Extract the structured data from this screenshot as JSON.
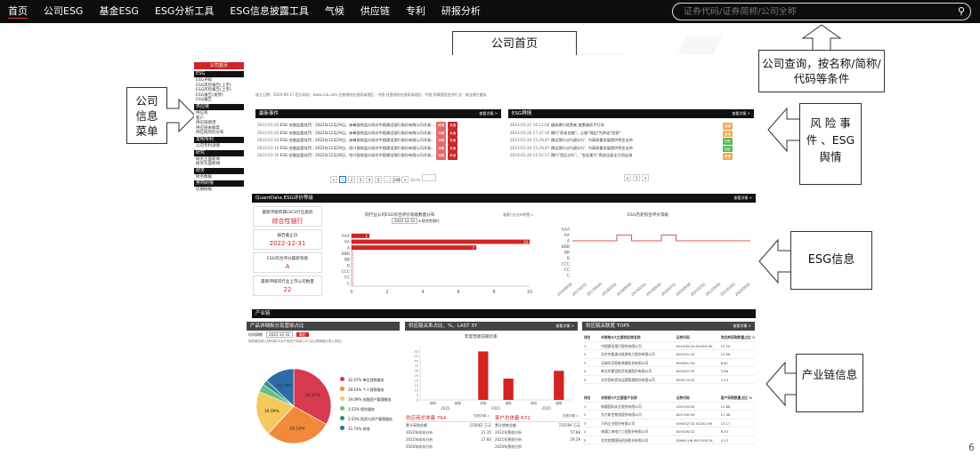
{
  "topnav": {
    "items": [
      "首页",
      "公司ESG",
      "基金ESG",
      "ESG分析工具",
      "ESG信息披露工具",
      "气候",
      "供应链",
      "专利",
      "研报分析"
    ],
    "search_placeholder": "证券代码/证券简称/公司全称",
    "search_icon": "search-icon"
  },
  "callouts": {
    "home": "公司首页",
    "query": "公司查询，按名称/简称/代码等条件",
    "menu": "公司\n信息\n菜单",
    "risk": "风 险 事件 、ESG舆情",
    "esg": "ESG信息",
    "supply": "产业链信息"
  },
  "page_number": "6",
  "dash": {
    "sidebar": {
      "header": "公司首页",
      "groups": [
        {
          "title": "ESG",
          "items": [
            "ESG评级",
            "ESG风险报告(上市)",
            "ESG风险报告(上市)",
            "ESG报告(发债)",
            "ESG报告"
          ]
        },
        {
          "title": "供应链",
          "items": [
            "供应商",
            "客户",
            "供应链图谱",
            "供应链关联度",
            "供应链风险分布"
          ]
        },
        {
          "title": "发明专利",
          "items": [
            "公司专利详情"
          ]
        },
        {
          "title": "研究",
          "items": [
            "研究正面新闻",
            "研究负面新闻"
          ]
        },
        {
          "title": "财务",
          "items": [
            "财务数据"
          ]
        },
        {
          "title": "券商研报",
          "items": [
            "近期研报"
          ]
        }
      ]
    },
    "info_line": "成立日期：2004-09-17    官方网站：www.ccb.com    注册地所在国家或地区：中国    经营地所在国家或地区：中国    所属国民经济行业：商业银行服务",
    "events": {
      "title": "最新事件",
      "more": "查看详情 >",
      "rows": [
        {
          "date": "2023-01-20",
          "text": "ESG-金融监管处罚：2022年12月29日，赤峰银保监分局对中国建设银行股份有限公司开具...",
          "tags": [
            "舆情",
            "负面"
          ]
        },
        {
          "date": "2023-01-20",
          "text": "ESG-金融监管处罚：2022年12月29日，赤峰银保监分局对中国建设银行股份有限公司开具...",
          "tags": [
            "舆情",
            "负面"
          ]
        },
        {
          "date": "2023-01-20",
          "text": "ESG-金融监管处罚：2022年12月29日，赤峰银保监分局对中国建设银行股份有限公司开具...",
          "tags": [
            "舆情",
            "负面"
          ]
        },
        {
          "date": "2023-01-10",
          "text": "ESG-金融监管处罚：2022年12月29日，绍兴银保监分局对中国建设银行股份有限公司开具...",
          "tags": [
            "舆情",
            "负面"
          ]
        },
        {
          "date": "2023-01-10",
          "text": "ESG-金融监管处罚：2022年12月29日，绍兴银保监分局对中国建设银行股份有限公司开具...",
          "tags": [
            "舆情",
            "负面"
          ]
        }
      ],
      "pages": [
        "1",
        "2",
        "3",
        "4",
        "5",
        "...",
        "206"
      ],
      "goto": "Go to"
    },
    "opinion": {
      "title": "ESG舆情",
      "more": "查看详情 >",
      "rows": [
        {
          "date": "2023-01-21 16:12:00",
          "text": "媒体建行经营者 普惠服务不打烊",
          "tag": "普通"
        },
        {
          "date": "2023-01-20 17:37:20",
          "text": "建行\"养老金融\"，让服\"锦田\"为四化\"回答\"",
          "tag": "普通"
        },
        {
          "date": "2023-01-20 15:29:47",
          "text": "建设银行分行副分行：为高质量发展提供资金支持",
          "tag": "利好"
        },
        {
          "date": "2023-01-20 15:29:47",
          "text": "建设银行分行副分行：为高质量发展提供资金支持",
          "tag": "利好"
        },
        {
          "date": "2023-01-20 11:52:17",
          "text": "建行\"西区分行\"，\"金征建大\"再加全面全力而出来",
          "tag": "普通"
        }
      ],
      "pages": [
        "<",
        "1",
        ">"
      ]
    },
    "rating": {
      "title": "QuantData ESG评价等级",
      "more": "查看详情 >",
      "cards": [
        {
          "label": "最新评级所属GICS行业类别",
          "value": "综合性银行"
        },
        {
          "label": "报告截止日",
          "value": "2022-12-31"
        },
        {
          "label": "ESG综合评分最新等级",
          "value": "A"
        },
        {
          "label": "最新评级同行业上市公司数量",
          "value": "22"
        }
      ],
      "dist_title": "同行业公司ESG综合评价等级数量分布",
      "dist_select": "2022-12-31",
      "dist_select2": "综合性银行",
      "dist_link": "查看行业分布明细 >",
      "hist_title": "ESG历史综合评价等级"
    },
    "supply": {
      "title": "产业链",
      "rev": {
        "title": "产品详细拆分及营收占比",
        "time_label": "时间周期",
        "time_value": "2021-12-31",
        "button": "确定",
        "note": "按类营业收入排名前10大产品在产品收入中占比(按照营业收入排名)"
      },
      "ratio": {
        "title": "供应链关系占比、%、LAST 3Y",
        "more": "查看详情 >",
        "chart_title": "年度营收前期比率"
      },
      "tops": {
        "title": "供应链关联度 TOP5",
        "more": "查看详情 >",
        "h1": [
          "排名",
          "关联前5大主要供应商名称",
          "证券代码",
          "供应商采购数量占比 %"
        ],
        "rows1": [
          [
            "1",
            "中国建设银行股份有限公司",
            "601939.SH,00939.HK",
            "13.20"
          ],
          [
            "2",
            "北京京能清洁能源电力股份有限公司",
            "600101.SZ",
            "12.96"
          ],
          [
            "3",
            "无锡先导智能装备股份有限公司",
            "600061.SH",
            "8.61"
          ],
          [
            "4",
            "新北京建设投资发展股份有限公司",
            "600087.SZ",
            "3.66"
          ],
          [
            "5",
            "北京国有资本运营管理股份有限公司",
            "600074.SZ",
            "2.23"
          ]
        ],
        "h2": [
          "排名",
          "关联前5大主要客户名称",
          "证券代码",
          "客户采购数量占比 %"
        ],
        "rows2": [
          [
            "1",
            "新疆国际实业股份有限公司",
            "000159.SZ",
            "21.68"
          ],
          [
            "2",
            "东方航空物流股份有限公司",
            "601156.SH",
            "17.46"
          ],
          [
            "3",
            "万科企业股份有限公司",
            "000002.SZ,02202.HK",
            "13.17"
          ],
          [
            "4",
            "南通江海电力工程股份有限公司",
            "600326.SZ",
            "8.20"
          ],
          [
            "5",
            "北京首都国际机场股份有限公司",
            "00694.HK,601558.SH",
            "4.13"
          ]
        ]
      },
      "supplier_stat": {
        "label": "供应商总体量",
        "value": "764",
        "more": "查看详情 >",
        "rows": [
          [
            "累计采购金额",
            "235662 万元"
          ],
          [
            "2022年成本分析",
            "21.35"
          ],
          [
            "2021年成本分析",
            "27.84"
          ],
          [
            "2020年成本分析",
            ""
          ]
        ]
      },
      "customer_stat": {
        "label": "客户总体量",
        "value": "672",
        "more": "查看详情 >",
        "rows": [
          [
            "累计销售金额",
            "735594 万元"
          ],
          [
            "2022年营收分析",
            "57.88"
          ],
          [
            "2021年营收分析",
            "29.29"
          ],
          [
            "2020年营收分析",
            ""
          ]
        ]
      }
    }
  },
  "chart_data": [
    {
      "type": "bar",
      "title": "同行业公司ESG综合评价等级数量分布",
      "categories": [
        "AAA",
        "AA",
        "A",
        "BBB",
        "BB",
        "B",
        "CCC",
        "CC",
        "C"
      ],
      "values": [
        1,
        10,
        7,
        0,
        0,
        0,
        0,
        0,
        0
      ],
      "xlim": [
        0,
        10
      ],
      "colors": [
        "#d42323"
      ]
    },
    {
      "type": "line",
      "title": "ESG历史综合评价等级",
      "y_categories": [
        "AAA",
        "AA",
        "A",
        "BBB",
        "BB",
        "B",
        "CCC",
        "CC",
        "C"
      ],
      "x": [
        "20160930",
        "20170331",
        "20170930",
        "20180331",
        "20180930",
        "20190331",
        "20190930",
        "20200331",
        "20200930",
        "20210331",
        "20210930",
        "20220331",
        "20220930"
      ],
      "values": [
        "A",
        "A",
        "A",
        "AA",
        "A",
        "A",
        "AA",
        "A",
        "A",
        "A",
        "A",
        "A",
        "A"
      ],
      "color": "#d42323"
    },
    {
      "type": "pie",
      "slices": [
        {
          "label": "32.47% 单位贷款服务",
          "value": 32.47,
          "color": "#d63b4f"
        },
        {
          "label": "28.14% 个人贷款服务",
          "value": 28.14,
          "color": "#f2893a"
        },
        {
          "label": "19.09% 金融资产管理服务",
          "value": 19.09,
          "color": "#f4c95e"
        },
        {
          "label": "3.52% 保险服务",
          "value": 3.52,
          "color": "#6cc084"
        },
        {
          "label": "2.03% 投资与资产管理服务",
          "value": 2.03,
          "color": "#2d8c8c"
        },
        {
          "label": "12.74% 其他",
          "value": 12.74,
          "color": "#2e6ca8"
        }
      ]
    },
    {
      "type": "bar",
      "title": "年度营收前期比率",
      "categories": [
        "2022 采购",
        "2022 销售",
        "2021 采购",
        "2021 销售",
        "2020 采购",
        "2020 销售"
      ],
      "values": [
        0,
        0,
        50,
        22,
        0,
        30
      ],
      "ylim": [
        0,
        55
      ],
      "color": "#d42323"
    }
  ]
}
